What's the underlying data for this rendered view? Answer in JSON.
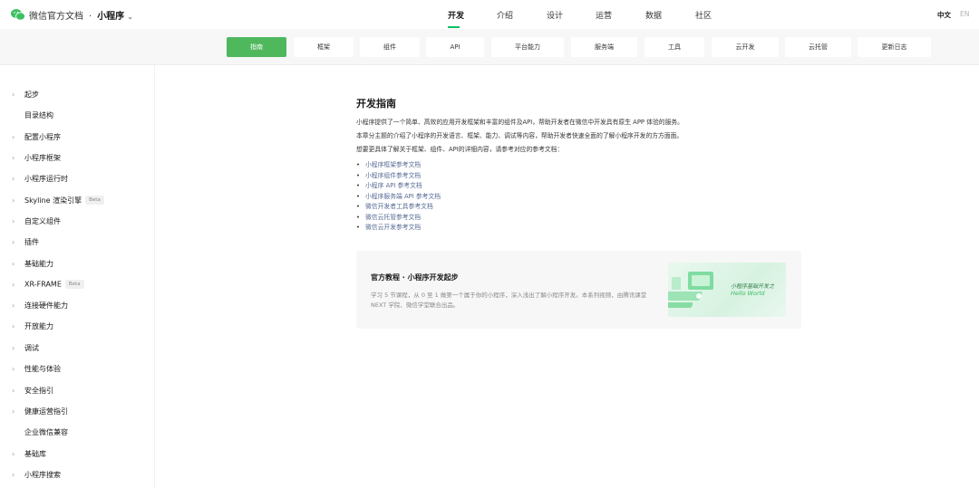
{
  "header": {
    "brand": "微信官方文档",
    "separator": "·",
    "product": "小程序",
    "nav": [
      "开发",
      "介绍",
      "设计",
      "运营",
      "数据",
      "社区"
    ],
    "active_nav": "开发",
    "lang_zh": "中文",
    "lang_en": "EN"
  },
  "subnav": {
    "items": [
      "指南",
      "框架",
      "组件",
      "API",
      "平台能力",
      "服务端",
      "工具",
      "云开发",
      "云托管",
      "更新日志"
    ],
    "active": "指南"
  },
  "sidebar": {
    "items": [
      {
        "label": "起步",
        "arrow": true
      },
      {
        "label": "目录结构",
        "arrow": false
      },
      {
        "label": "配置小程序",
        "arrow": true
      },
      {
        "label": "小程序框架",
        "arrow": true
      },
      {
        "label": "小程序运行时",
        "arrow": true
      },
      {
        "label": "Skyline 渲染引擎",
        "arrow": true,
        "badge": "Beta"
      },
      {
        "label": "自定义组件",
        "arrow": true
      },
      {
        "label": "插件",
        "arrow": true
      },
      {
        "label": "基础能力",
        "arrow": true
      },
      {
        "label": "XR-FRAME",
        "arrow": true,
        "badge": "Beta"
      },
      {
        "label": "连接硬件能力",
        "arrow": true
      },
      {
        "label": "开放能力",
        "arrow": true
      },
      {
        "label": "调试",
        "arrow": true
      },
      {
        "label": "性能与体验",
        "arrow": true
      },
      {
        "label": "安全指引",
        "arrow": true
      },
      {
        "label": "健康运营指引",
        "arrow": true
      },
      {
        "label": "企业微信兼容",
        "arrow": false
      },
      {
        "label": "基础库",
        "arrow": true
      },
      {
        "label": "小程序搜索",
        "arrow": true
      }
    ]
  },
  "content": {
    "title": "开发指南",
    "paragraphs": [
      "小程序提供了一个简单、高效的应用开发框架和丰富的组件及API，帮助开发者在微信中开发具有原生 APP 体验的服务。",
      "本章分主题的介绍了小程序的开发语言、框架、能力、调试等内容，帮助开发者快速全面的了解小程序开发的方方面面。",
      "想要更具体了解关于框架、组件、API的详细内容，请参考对应的参考文档："
    ],
    "links": [
      "小程序框架参考文档",
      "小程序组件参考文档",
      "小程序 API 参考文档",
      "小程序服务端 API 参考文档",
      "微信开发者工具参考文档",
      "微信云托管参考文档",
      "微信云开发参考文档"
    ]
  },
  "card": {
    "title": "官方教程 · 小程序开发起步",
    "desc": "学习 5 节课程，从 0 至 1 做第一个属于你的小程序，深入浅出了解小程序开发。本系列视频，由腾讯课堂 NEXT 学院、微信学堂联合出品。",
    "img_line1": "小程序基础开发之",
    "img_line2": "Hello World"
  },
  "colors": {
    "accent": "#07c160",
    "active_tab": "#4fb85d",
    "link": "#576b95"
  }
}
